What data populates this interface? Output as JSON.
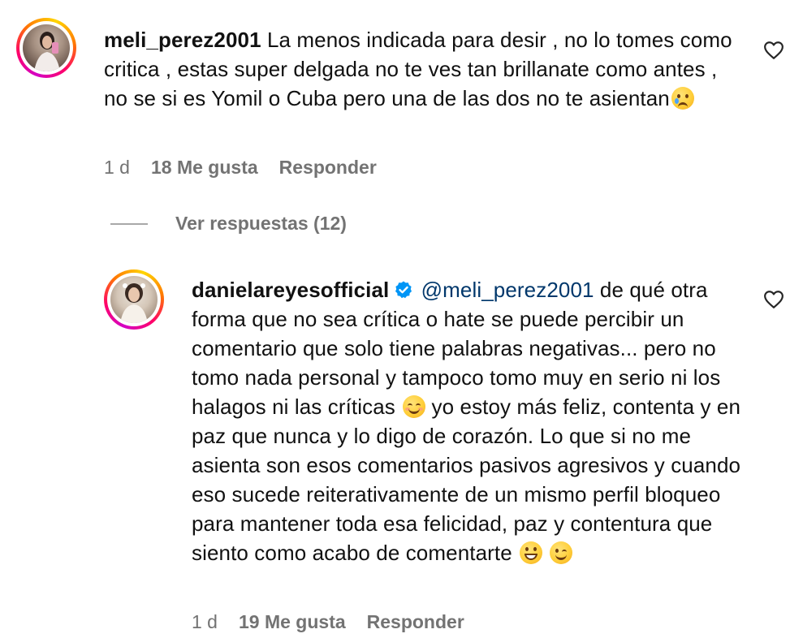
{
  "comments": [
    {
      "username": "meli_perez2001",
      "text": "La menos indicada para desir , no lo tomes como critica , estas super delgada no te ves tan brillanate como antes , no se si es Yomil o Cuba pero una de las dos no te asientan",
      "emoji": "crying-face",
      "time": "1 d",
      "likes": "18 Me gusta",
      "reply_label": "Responder"
    },
    {
      "username": "danielareyesofficial",
      "verified": true,
      "mention": "@meli_perez2001",
      "text_part1": "de qué otra forma que no sea crítica o hate se puede percibir un comentario que solo tiene palabras negativas... pero no tomo nada personal y tampoco tomo muy en serio ni los halagos ni las críticas",
      "emoji1": "smiling-face",
      "text_part2": "yo estoy más feliz, contenta y en paz que nunca y lo digo de corazón. Lo que si no me asienta son esos comentarios pasivos agresivos y cuando eso sucede reiterativamente de un mismo perfil bloqueo para mantener toda esa felicidad, paz y contentura que siento como acabo de comentarte",
      "emoji2": "grinning-face",
      "emoji3": "winking-face",
      "time": "1 d",
      "likes": "19 Me gusta",
      "reply_label": "Responder"
    }
  ],
  "view_replies": "Ver respuestas (12)",
  "colors": {
    "text": "#111111",
    "meta": "#737373",
    "mention": "#00376b",
    "verified": "#0095f6"
  }
}
